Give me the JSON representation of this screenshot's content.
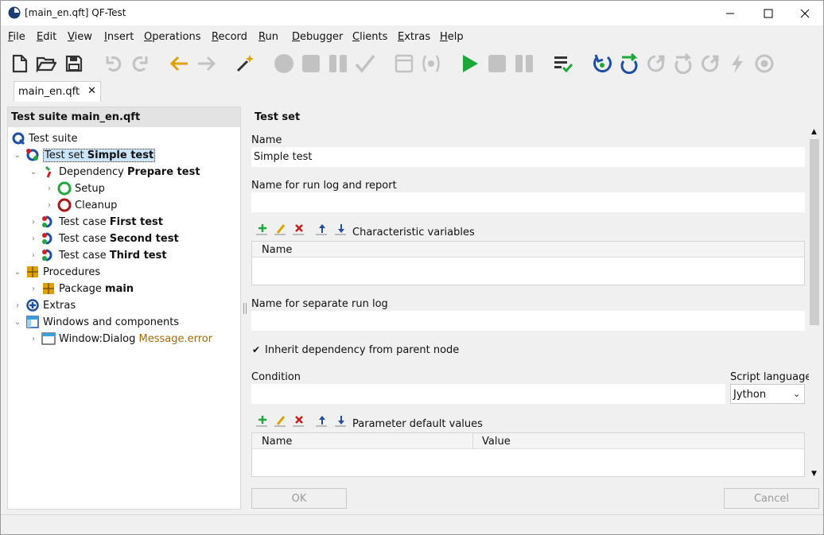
{
  "window": {
    "title": "[main_en.qft] QF-Test"
  },
  "menu": [
    "File",
    "Edit",
    "View",
    "Insert",
    "Operations",
    "Record",
    "Run",
    "Debugger",
    "Clients",
    "Extras",
    "Help"
  ],
  "tabs": [
    {
      "label": "main_en.qft",
      "close": "✕"
    }
  ],
  "tree": {
    "header": "Test suite main_en.qft",
    "nodes": [
      {
        "type": "Test suite",
        "name": ""
      },
      {
        "type": "Test set",
        "name": "Simple test"
      },
      {
        "type": "Dependency",
        "name": "Prepare test"
      },
      {
        "type": "Setup",
        "name": ""
      },
      {
        "type": "Cleanup",
        "name": ""
      },
      {
        "type": "Test case",
        "name": "First test"
      },
      {
        "type": "Test case",
        "name": "Second test"
      },
      {
        "type": "Test case",
        "name": "Third test"
      },
      {
        "type": "Procedures",
        "name": ""
      },
      {
        "type": "Package",
        "name": "main"
      },
      {
        "type": "Extras",
        "name": ""
      },
      {
        "type": "Windows and components",
        "name": ""
      },
      {
        "type": "Window:Dialog",
        "name": "Message.error"
      }
    ]
  },
  "detail": {
    "title": "Test set",
    "name_label": "Name",
    "name_value": "Simple test",
    "runlog_label": "Name for run log and report",
    "runlog_value": "",
    "char_vars_label": "Characteristic variables",
    "char_vars_columns": [
      "Name"
    ],
    "separate_label": "Name for separate run log",
    "separate_value": "",
    "inherit_label": "Inherit dependency from parent node",
    "inherit_checked": true,
    "condition_label": "Condition",
    "condition_value": "",
    "script_lang_label": "Script language",
    "script_lang_value": "Jython",
    "params_label": "Parameter default values",
    "params_columns": [
      "Name",
      "Value"
    ],
    "ok": "OK",
    "cancel": "Cancel"
  },
  "icons": [
    "app-icon",
    "new-file-icon",
    "open-folder-icon",
    "save-icon",
    "undo-icon",
    "redo-icon",
    "back-arrow-icon",
    "forward-arrow-icon",
    "magic-wand-icon",
    "record-icon",
    "stop-record-icon",
    "pause-record-icon",
    "check-icon",
    "window-icon",
    "component-icon",
    "play-icon",
    "stop-icon",
    "pause-icon",
    "checklist-icon",
    "step-in-icon",
    "step-over-icon"
  ]
}
